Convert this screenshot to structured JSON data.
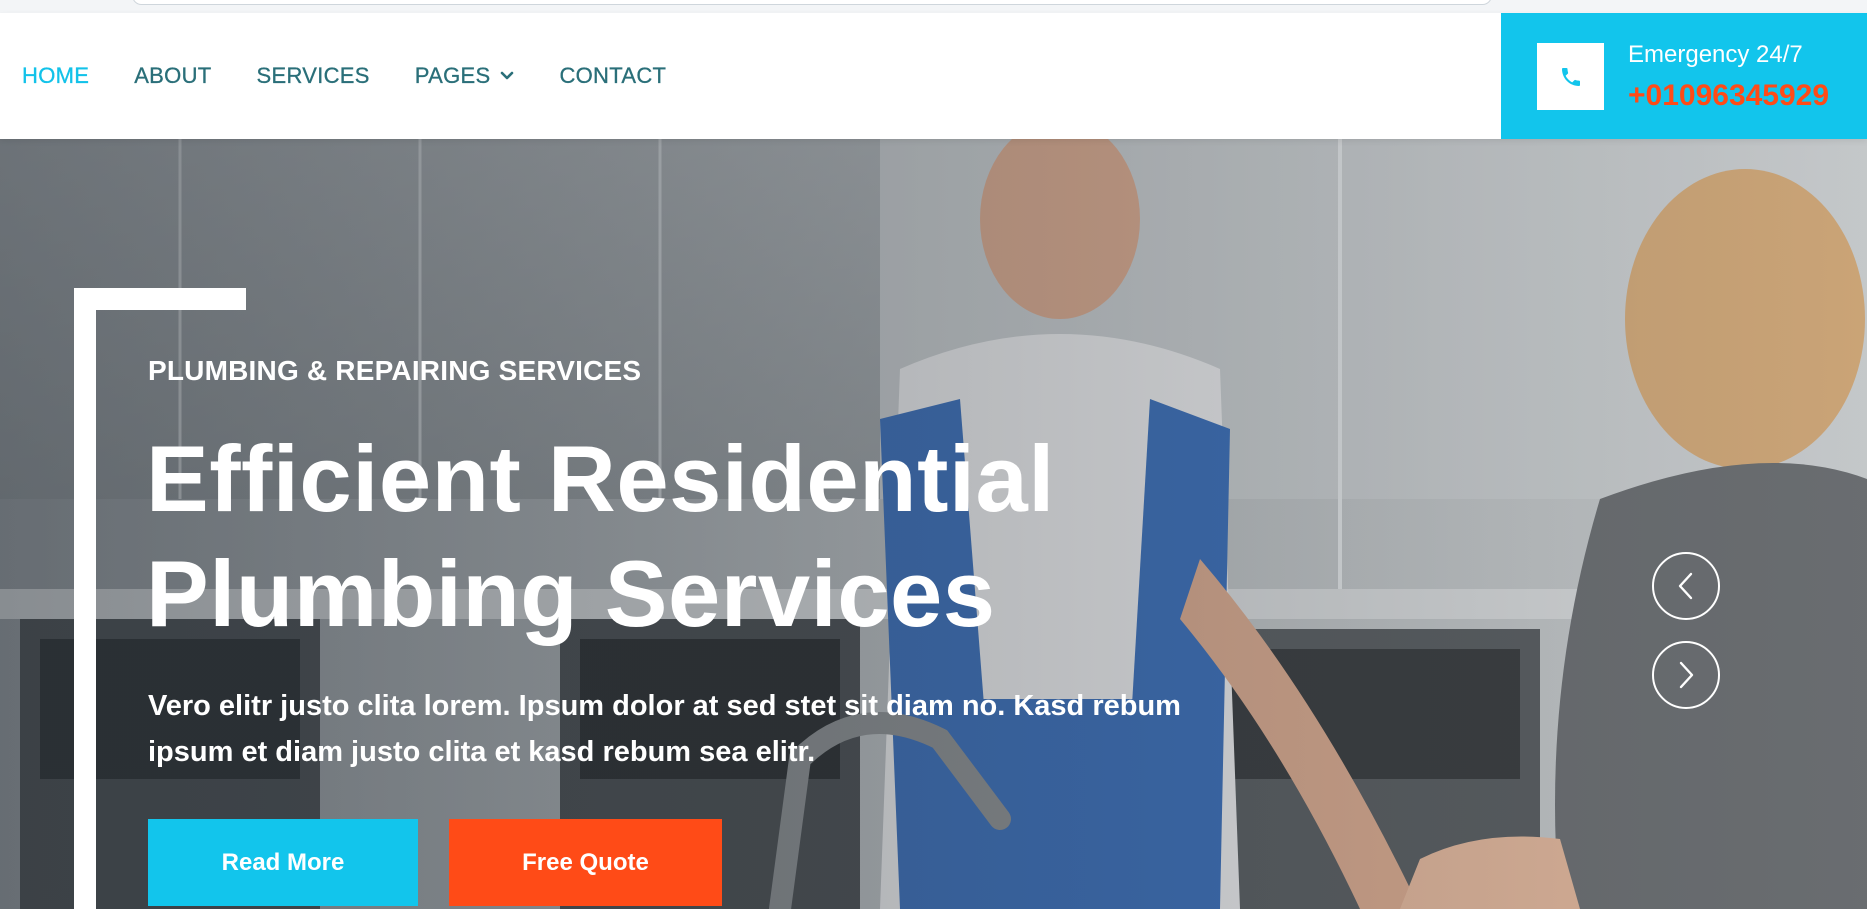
{
  "nav": {
    "items": [
      {
        "label": "HOME",
        "active": true
      },
      {
        "label": "ABOUT"
      },
      {
        "label": "SERVICES"
      },
      {
        "label": "PAGES",
        "has_dropdown": true
      },
      {
        "label": "CONTACT"
      }
    ]
  },
  "emergency": {
    "label": "Emergency 24/7",
    "phone": "+01096345929",
    "icon": "phone-icon"
  },
  "hero": {
    "kicker": "PLUMBING & REPAIRING SERVICES",
    "headline_line1": "Efficient Residential",
    "headline_line2": "Plumbing Services",
    "lead": "Vero elitr justo clita lorem. Ipsum dolor at sed stet sit diam no. Kasd rebum ipsum et diam justo clita et kasd rebum sea elitr.",
    "read_more": "Read More",
    "free_quote": "Free Quote",
    "prev_icon": "chevron-left-icon",
    "next_icon": "chevron-right-icon"
  },
  "colors": {
    "primary": "#12c5ec",
    "secondary": "#ff4b17",
    "nav_text": "#2a6f79"
  }
}
